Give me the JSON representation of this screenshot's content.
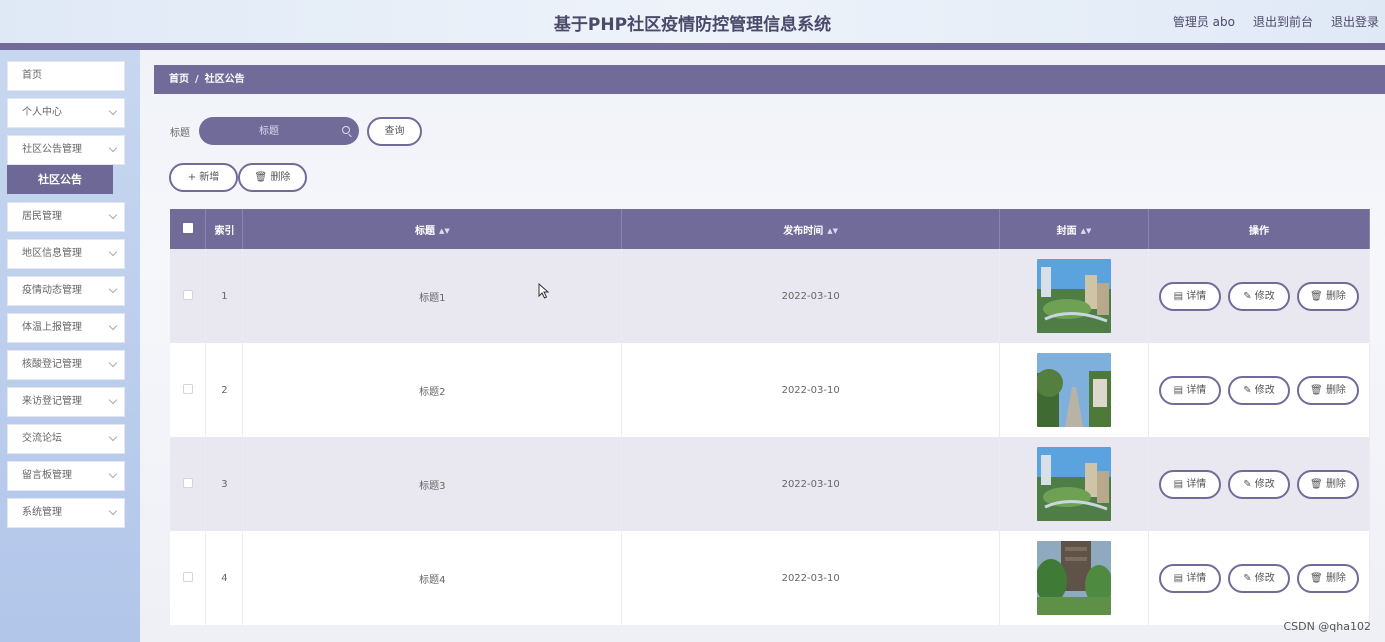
{
  "header": {
    "title": "基于PHP社区疫情防控管理信息系统",
    "links": [
      "管理员 abo",
      "退出到前台",
      "退出登录"
    ]
  },
  "sidebar": {
    "items": [
      "首页",
      "个人中心",
      "社区公告管理",
      "居民管理",
      "地区信息管理",
      "疫情动态管理",
      "体温上报管理",
      "核酸登记管理",
      "来访登记管理",
      "交流论坛",
      "留言板管理",
      "系统管理"
    ],
    "active_sub": "社区公告"
  },
  "breadcrumb": {
    "home": "首页",
    "sep": "/",
    "current": "社区公告"
  },
  "search": {
    "label": "标题",
    "placeholder": "标题",
    "button": "查询"
  },
  "actions": {
    "add": "新增",
    "delete": "删除"
  },
  "table": {
    "headers": {
      "index": "索引",
      "title": "标题",
      "date": "发布时间",
      "cover": "封面",
      "ops": "操作"
    },
    "rows": [
      {
        "index": "1",
        "title": "标题1",
        "date": "2022-03-10"
      },
      {
        "index": "2",
        "title": "标题2",
        "date": "2022-03-10"
      },
      {
        "index": "3",
        "title": "标题3",
        "date": "2022-03-10"
      },
      {
        "index": "4",
        "title": "标题4",
        "date": "2022-03-10"
      }
    ],
    "row_buttons": {
      "detail": "详情",
      "edit": "修改",
      "delete": "删除"
    }
  },
  "watermark": "CSDN @qha102",
  "colors": {
    "accent": "#716b99",
    "header_text": "#4c4a6b"
  }
}
